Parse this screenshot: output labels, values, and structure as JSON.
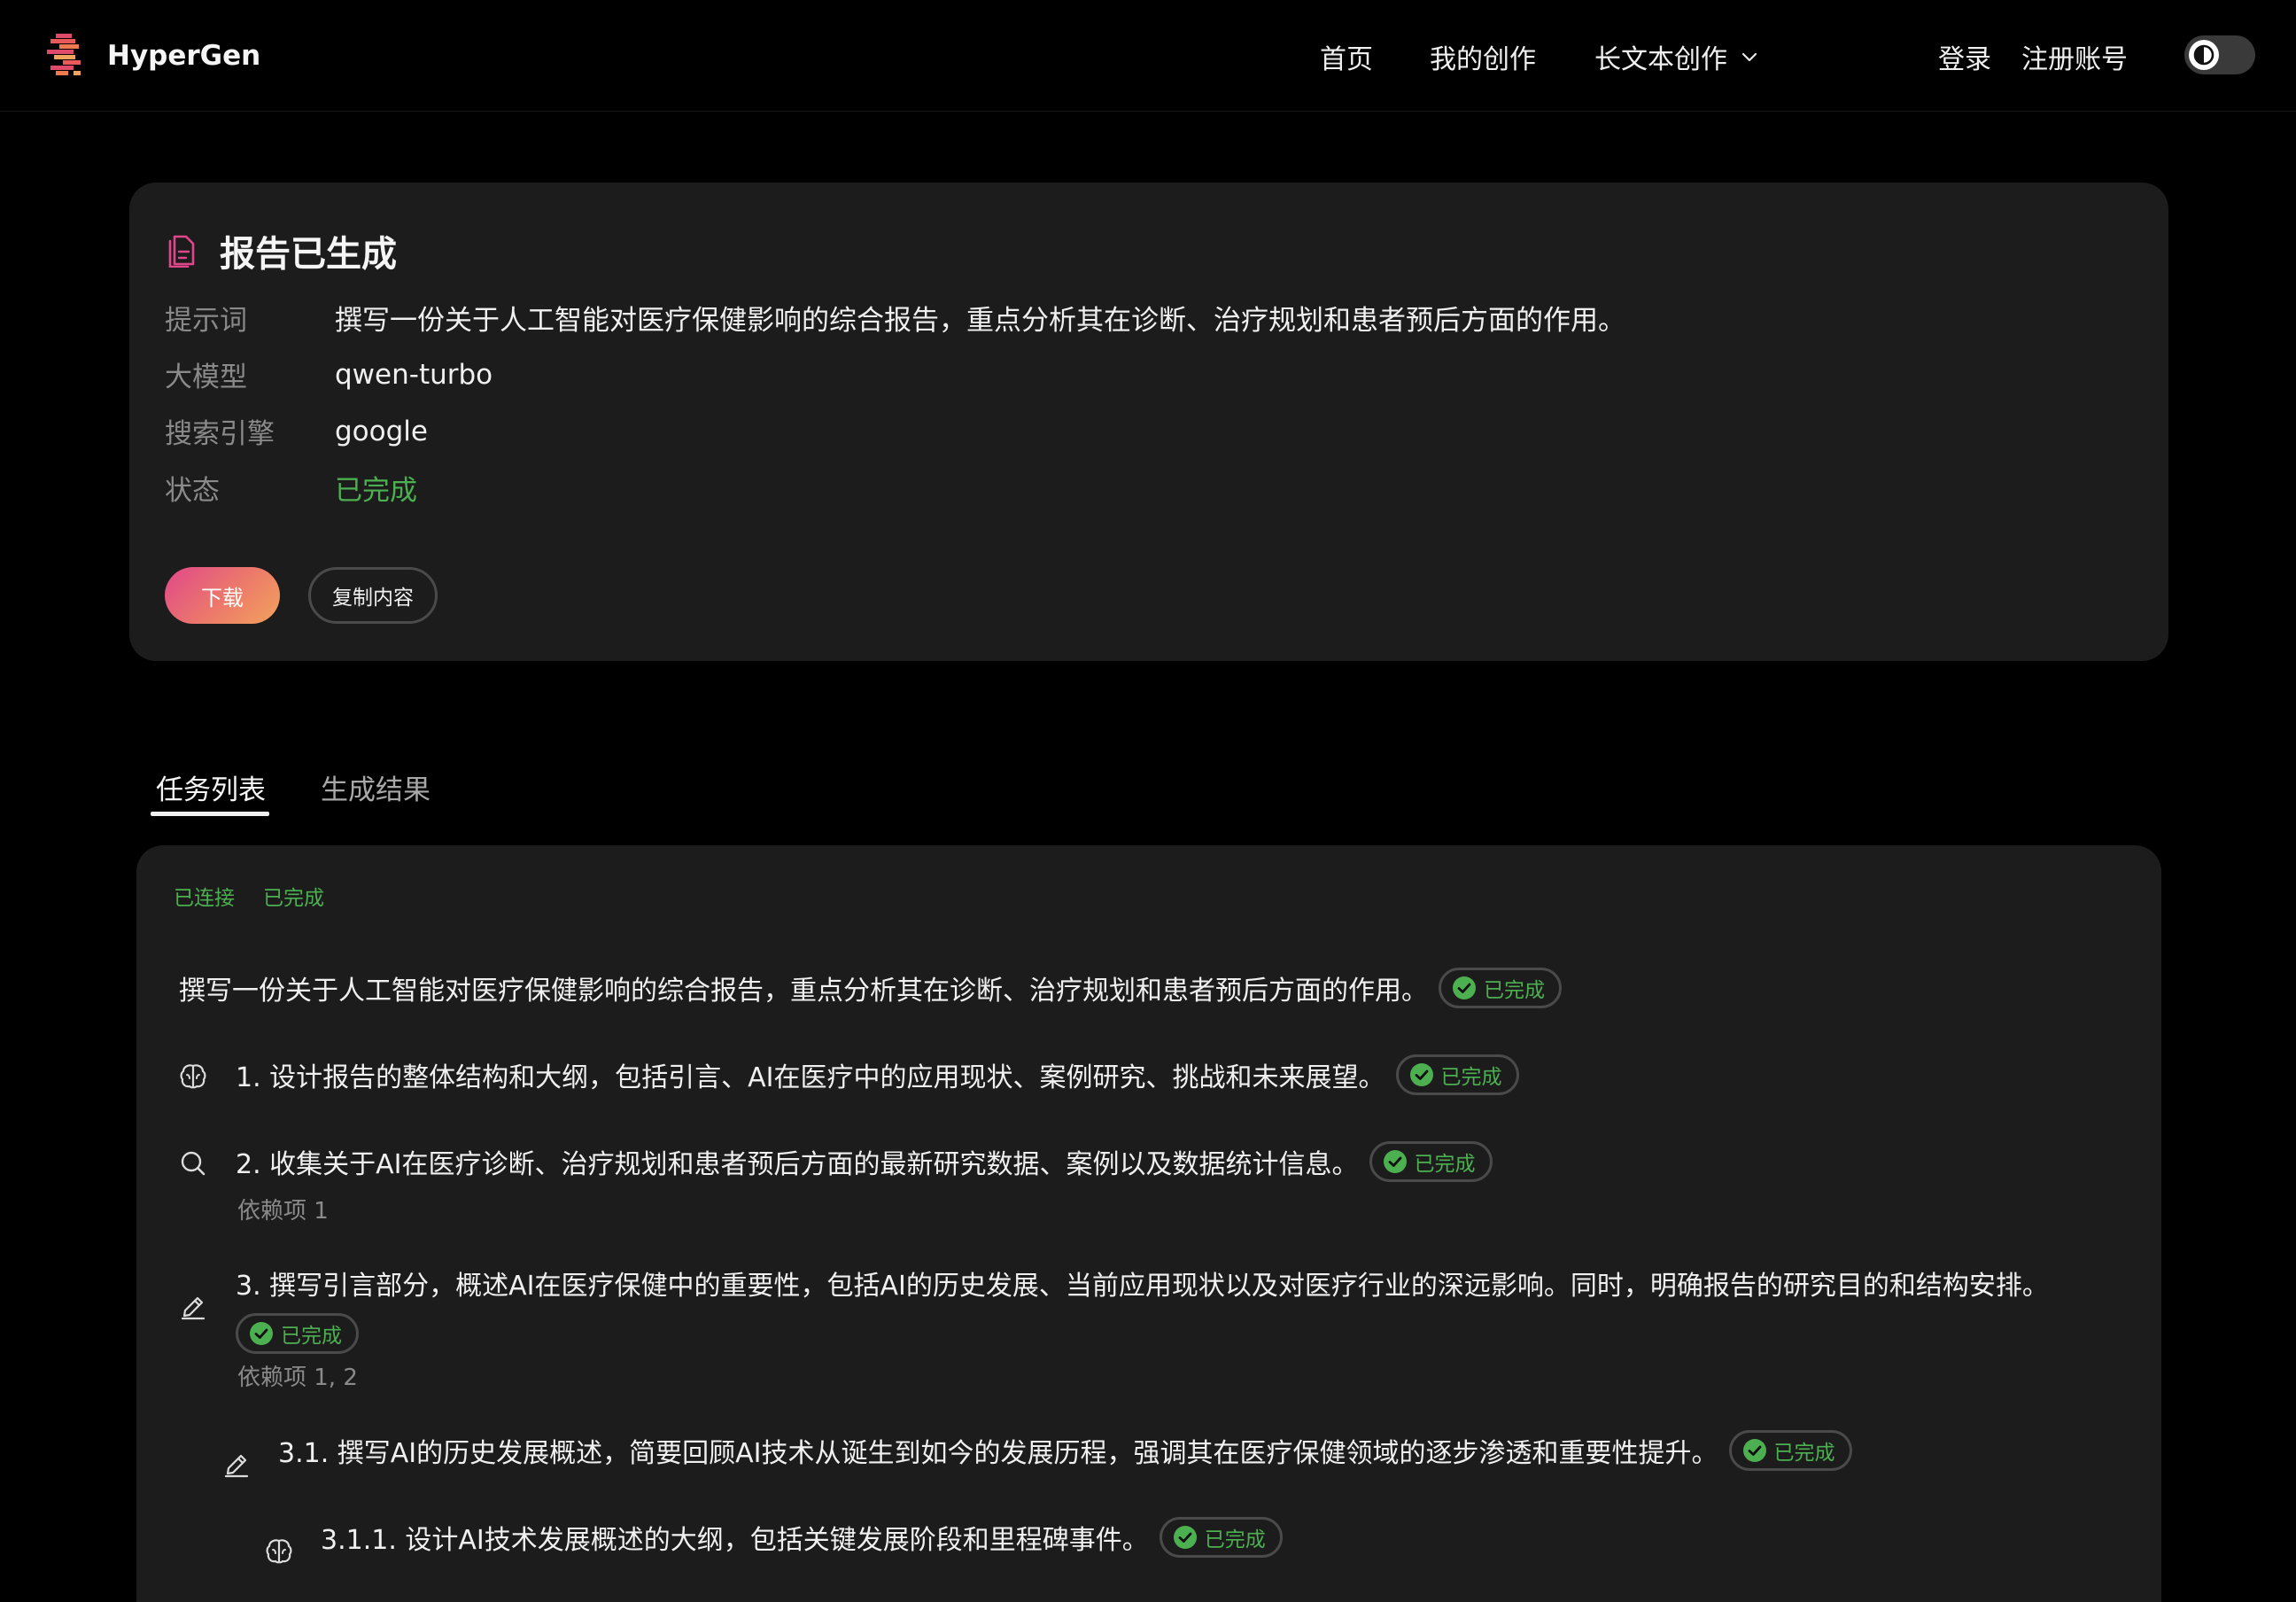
{
  "nav": {
    "brand": "HyperGen",
    "links": {
      "home": "首页",
      "my_creations": "我的创作",
      "long_text": "长文本创作"
    },
    "login": "登录",
    "signup": "注册账号"
  },
  "report": {
    "title": "报告已生成",
    "meta": [
      {
        "label": "提示词",
        "value": "撰写一份关于人工智能对医疗保健影响的综合报告，重点分析其在诊断、治疗规划和患者预后方面的作用。"
      },
      {
        "label": "大模型",
        "value": "qwen-turbo"
      },
      {
        "label": "搜索引擎",
        "value": "google"
      },
      {
        "label": "状态",
        "value": "已完成"
      }
    ],
    "download_label": "下载",
    "copy_label": "复制内容"
  },
  "tabs": [
    {
      "label": "任务列表",
      "active": true
    },
    {
      "label": "生成结果",
      "active": false
    }
  ],
  "task_panel": {
    "status_tags": [
      "已连接",
      "已完成"
    ],
    "badge_label": "已完成",
    "root_task": "撰写一份关于人工智能对医疗保健影响的综合报告，重点分析其在诊断、治疗规划和患者预后方面的作用。",
    "tasks": [
      {
        "icon": "brain-icon",
        "text": "1. 设计报告的整体结构和大纲，包括引言、AI在医疗中的应用现状、案例研究、挑战和未来展望。",
        "status": "已完成"
      },
      {
        "icon": "search-icon",
        "text": "2. 收集关于AI在医疗诊断、治疗规划和患者预后方面的最新研究数据、案例以及数据统计信息。",
        "status": "已完成",
        "deps": "依赖项 1"
      },
      {
        "icon": "pencil-icon",
        "text": "3. 撰写引言部分，概述AI在医疗保健中的重要性，包括AI的历史发展、当前应用现状以及对医疗行业的深远影响。同时，明确报告的研究目的和结构安排。",
        "status": "已完成",
        "deps": "依赖项 1, 2"
      },
      {
        "icon": "pencil-icon",
        "text": "3.1. 撰写AI的历史发展概述，简要回顾AI技术从诞生到如今的发展历程，强调其在医疗保健领域的逐步渗透和重要性提升。",
        "status": "已完成"
      },
      {
        "icon": "brain-icon",
        "text": "3.1.1. 设计AI技术发展概述的大纲，包括关键发展阶段和里程碑事件。",
        "status": "已完成"
      }
    ]
  },
  "colors": {
    "accent_green": "#4caf50",
    "card_bg": "#1c1c1d",
    "download_gradient_start": "#e0478a",
    "download_gradient_end": "#f2a35c"
  }
}
